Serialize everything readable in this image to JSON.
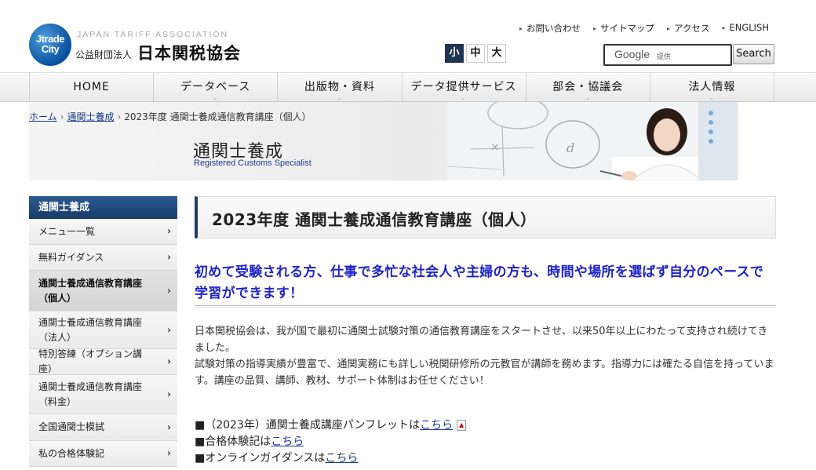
{
  "header": {
    "logo_mark": "Jtrade City",
    "logo_en": "JAPAN TARIFF ASSOCIATION",
    "logo_sub": "公益財団法人",
    "logo_main": "日本関税協会",
    "top_links": [
      "お問い合わせ",
      "サイトマップ",
      "アクセス",
      "ENGLISH"
    ],
    "font_sizes": [
      "小",
      "中",
      "大"
    ],
    "search": {
      "brand": "Google",
      "tag": "提供",
      "button": "Search"
    }
  },
  "nav": [
    "HOME",
    "データベース",
    "出版物・資料",
    "データ提供サービス",
    "部会・協議会",
    "法人情報"
  ],
  "breadcrumb": {
    "home": "ホーム",
    "parent": "通関士養成",
    "current": "2023年度 通関士養成通信教育講座（個人）"
  },
  "hero": {
    "title": "通関士養成",
    "subtitle": "Registered Customs Specialist"
  },
  "sidebar": {
    "heading": "通関士養成",
    "items": [
      "メニュー一覧",
      "無料ガイダンス",
      "通関士養成通信教育講座（個人）",
      "通関士養成通信教育講座（法人）",
      "特別答練（オプション講座）",
      "通関士養成通信教育講座（料金）",
      "全国通関士模試",
      "私の合格体験記"
    ]
  },
  "main": {
    "title": "2023年度 通関士養成通信教育講座（個人）",
    "lead": "初めて受験される方、仕事で多忙な社会人や主婦の方も、時間や場所を選ばず自分のペースで学習ができます！",
    "para1": "日本関税協会は、我が国で最初に通関士試験対策の通信教育講座をスタートさせ、以来50年以上にわたって支持され続けてきました。",
    "para2": "試験対策の指導実績が豊富で、通関実務にも詳しい税関研修所の元教官が講師を務めます。指導力には確たる自信を持っています。講座の品質、講師、教材、サポート体制はお任せください！",
    "links": [
      {
        "prefix": "■（2023年）通関士養成講座パンフレットは",
        "link": "こちら"
      },
      {
        "prefix": "■合格体験記は",
        "link": "こちら"
      },
      {
        "prefix": "■オンラインガイダンスは",
        "link": "こちら"
      }
    ]
  }
}
